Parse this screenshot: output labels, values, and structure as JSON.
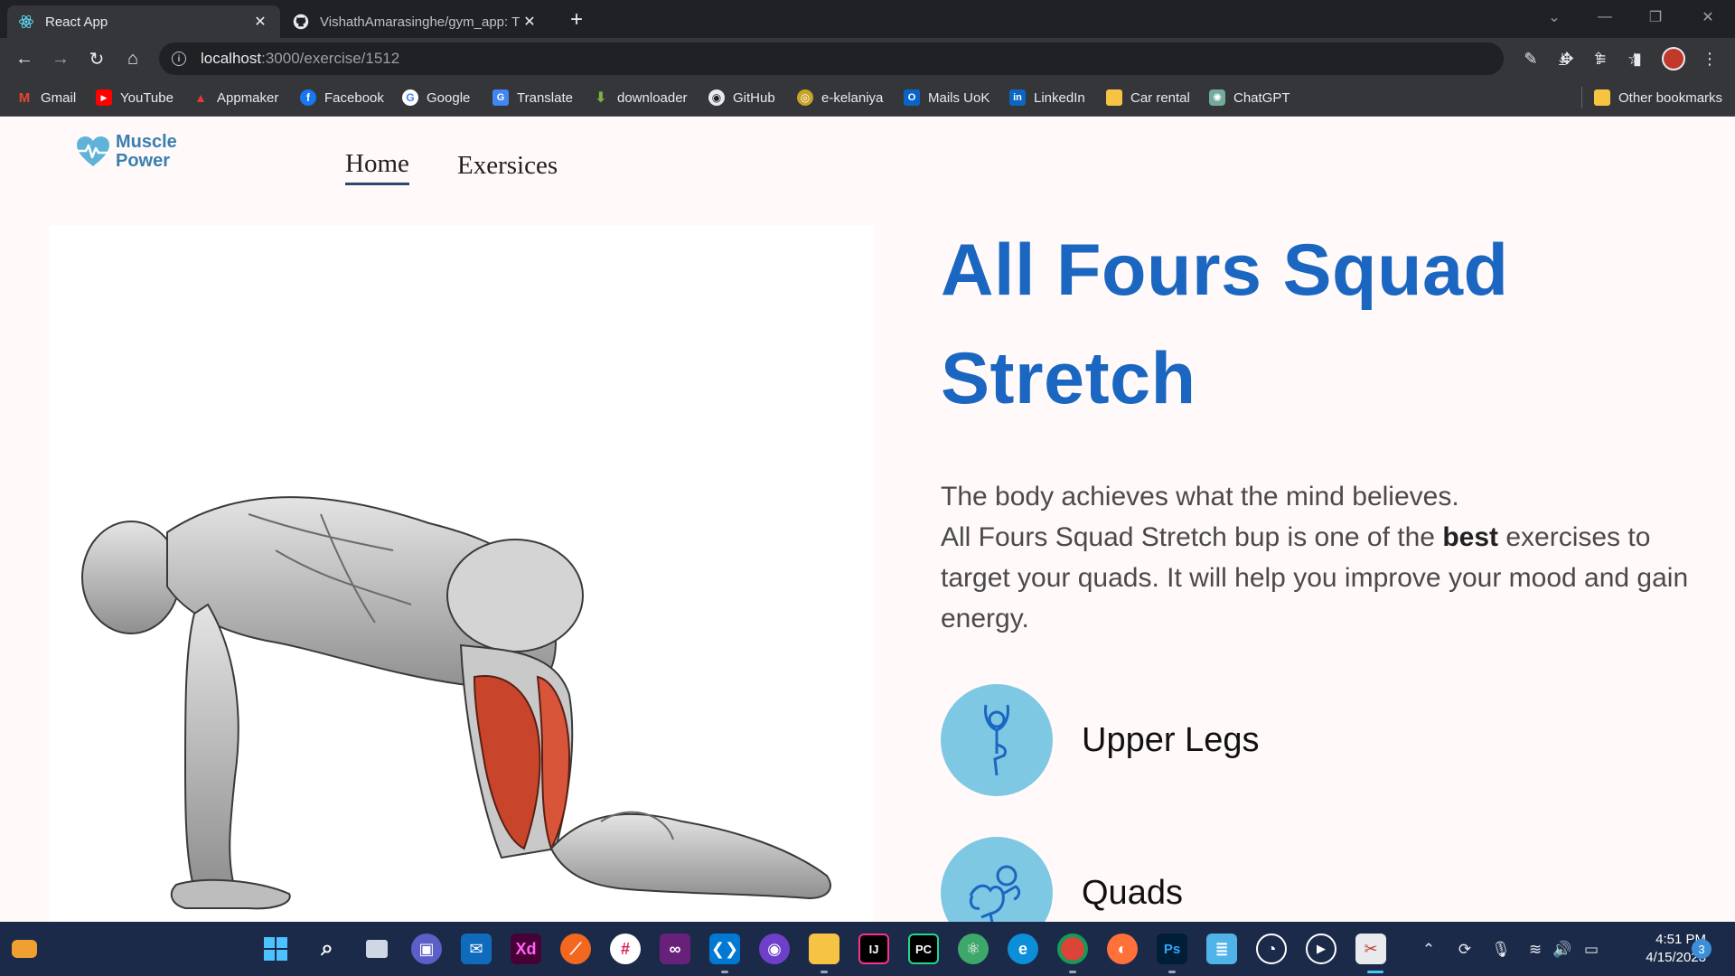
{
  "browser": {
    "tabs": [
      {
        "title": "React App",
        "icon": "react-icon"
      },
      {
        "title": "VishathAmarasinghe/gym_app: T",
        "icon": "github-icon"
      }
    ],
    "url_host": "localhost",
    "url_path": ":3000/exercise/1512",
    "bookmarks": [
      "Gmail",
      "YouTube",
      "Appmaker",
      "Facebook",
      "Google",
      "Translate",
      "downloader",
      "GitHub",
      "e-kelaniya",
      "Mails UoK",
      "LinkedIn",
      "Car rental",
      "ChatGPT"
    ],
    "other_bookmarks": "Other bookmarks"
  },
  "site": {
    "logo_line1": "Muscle",
    "logo_line2": "Power",
    "nav_home": "Home",
    "nav_exercises": "Exersices"
  },
  "exercise": {
    "title_line1": "All Fours Squad",
    "title_line2": "Stretch",
    "desc_line1": "The body achieves what the mind believes.",
    "desc_pre": "All Fours Squad Stretch bup is one of the ",
    "desc_bold": "best",
    "desc_post": " exercises to target your quads. It will help you improve your mood and gain energy.",
    "tags": [
      {
        "label": "Upper Legs",
        "icon": "body-part-icon"
      },
      {
        "label": "Quads",
        "icon": "target-muscle-icon"
      }
    ],
    "accent_color": "#1b66c0",
    "tag_circle_color": "#7ec8e3"
  },
  "taskbar": {
    "time": "4:51 PM",
    "date": "4/15/2023",
    "notifications": "3"
  }
}
